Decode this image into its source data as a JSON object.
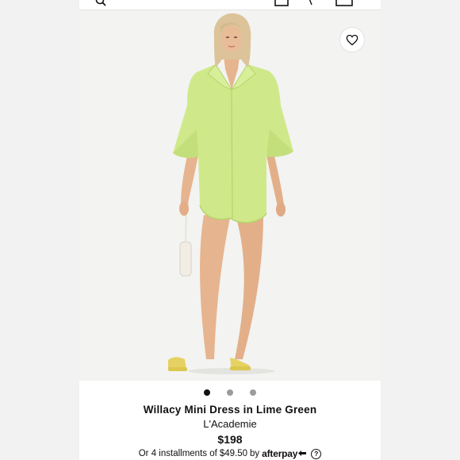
{
  "product": {
    "name": "Willacy Mini Dress in Lime Green",
    "brand": "L'Academie",
    "price": "$198",
    "installments": {
      "prefix": "Or 4 installments of",
      "amount": "$49.50",
      "by": "by",
      "provider": "afterpay",
      "help": "?"
    }
  },
  "carousel": {
    "total": 3,
    "active": 1
  },
  "icons": {
    "wishlist": "heart-icon",
    "topbar": [
      "search-icon",
      "account-icon",
      "bag-icon"
    ],
    "installment_help": "question-circle-icon",
    "provider_mark": "afterpay-arrows-icon"
  },
  "colors": {
    "dress": "#cfe98a",
    "dress_shadow": "#b5d36a",
    "skin": "#e6b48f",
    "hair": "#dcc39a",
    "text": "#111111",
    "dot_inactive": "#9c9c9c"
  }
}
